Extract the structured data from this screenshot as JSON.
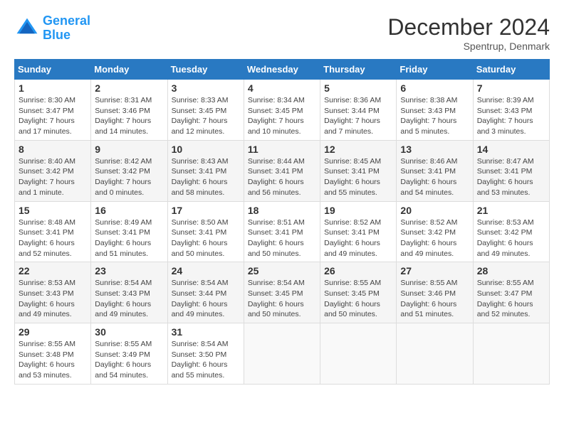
{
  "header": {
    "logo_line1": "General",
    "logo_line2": "Blue",
    "month": "December 2024",
    "location": "Spentrup, Denmark"
  },
  "weekdays": [
    "Sunday",
    "Monday",
    "Tuesday",
    "Wednesday",
    "Thursday",
    "Friday",
    "Saturday"
  ],
  "weeks": [
    [
      {
        "day": "1",
        "sunrise": "8:30 AM",
        "sunset": "3:47 PM",
        "daylight": "7 hours and 17 minutes."
      },
      {
        "day": "2",
        "sunrise": "8:31 AM",
        "sunset": "3:46 PM",
        "daylight": "7 hours and 14 minutes."
      },
      {
        "day": "3",
        "sunrise": "8:33 AM",
        "sunset": "3:45 PM",
        "daylight": "7 hours and 12 minutes."
      },
      {
        "day": "4",
        "sunrise": "8:34 AM",
        "sunset": "3:45 PM",
        "daylight": "7 hours and 10 minutes."
      },
      {
        "day": "5",
        "sunrise": "8:36 AM",
        "sunset": "3:44 PM",
        "daylight": "7 hours and 7 minutes."
      },
      {
        "day": "6",
        "sunrise": "8:38 AM",
        "sunset": "3:43 PM",
        "daylight": "7 hours and 5 minutes."
      },
      {
        "day": "7",
        "sunrise": "8:39 AM",
        "sunset": "3:43 PM",
        "daylight": "7 hours and 3 minutes."
      }
    ],
    [
      {
        "day": "8",
        "sunrise": "8:40 AM",
        "sunset": "3:42 PM",
        "daylight": "7 hours and 1 minute."
      },
      {
        "day": "9",
        "sunrise": "8:42 AM",
        "sunset": "3:42 PM",
        "daylight": "7 hours and 0 minutes."
      },
      {
        "day": "10",
        "sunrise": "8:43 AM",
        "sunset": "3:41 PM",
        "daylight": "6 hours and 58 minutes."
      },
      {
        "day": "11",
        "sunrise": "8:44 AM",
        "sunset": "3:41 PM",
        "daylight": "6 hours and 56 minutes."
      },
      {
        "day": "12",
        "sunrise": "8:45 AM",
        "sunset": "3:41 PM",
        "daylight": "6 hours and 55 minutes."
      },
      {
        "day": "13",
        "sunrise": "8:46 AM",
        "sunset": "3:41 PM",
        "daylight": "6 hours and 54 minutes."
      },
      {
        "day": "14",
        "sunrise": "8:47 AM",
        "sunset": "3:41 PM",
        "daylight": "6 hours and 53 minutes."
      }
    ],
    [
      {
        "day": "15",
        "sunrise": "8:48 AM",
        "sunset": "3:41 PM",
        "daylight": "6 hours and 52 minutes."
      },
      {
        "day": "16",
        "sunrise": "8:49 AM",
        "sunset": "3:41 PM",
        "daylight": "6 hours and 51 minutes."
      },
      {
        "day": "17",
        "sunrise": "8:50 AM",
        "sunset": "3:41 PM",
        "daylight": "6 hours and 50 minutes."
      },
      {
        "day": "18",
        "sunrise": "8:51 AM",
        "sunset": "3:41 PM",
        "daylight": "6 hours and 50 minutes."
      },
      {
        "day": "19",
        "sunrise": "8:52 AM",
        "sunset": "3:41 PM",
        "daylight": "6 hours and 49 minutes."
      },
      {
        "day": "20",
        "sunrise": "8:52 AM",
        "sunset": "3:42 PM",
        "daylight": "6 hours and 49 minutes."
      },
      {
        "day": "21",
        "sunrise": "8:53 AM",
        "sunset": "3:42 PM",
        "daylight": "6 hours and 49 minutes."
      }
    ],
    [
      {
        "day": "22",
        "sunrise": "8:53 AM",
        "sunset": "3:43 PM",
        "daylight": "6 hours and 49 minutes."
      },
      {
        "day": "23",
        "sunrise": "8:54 AM",
        "sunset": "3:43 PM",
        "daylight": "6 hours and 49 minutes."
      },
      {
        "day": "24",
        "sunrise": "8:54 AM",
        "sunset": "3:44 PM",
        "daylight": "6 hours and 49 minutes."
      },
      {
        "day": "25",
        "sunrise": "8:54 AM",
        "sunset": "3:45 PM",
        "daylight": "6 hours and 50 minutes."
      },
      {
        "day": "26",
        "sunrise": "8:55 AM",
        "sunset": "3:45 PM",
        "daylight": "6 hours and 50 minutes."
      },
      {
        "day": "27",
        "sunrise": "8:55 AM",
        "sunset": "3:46 PM",
        "daylight": "6 hours and 51 minutes."
      },
      {
        "day": "28",
        "sunrise": "8:55 AM",
        "sunset": "3:47 PM",
        "daylight": "6 hours and 52 minutes."
      }
    ],
    [
      {
        "day": "29",
        "sunrise": "8:55 AM",
        "sunset": "3:48 PM",
        "daylight": "6 hours and 53 minutes."
      },
      {
        "day": "30",
        "sunrise": "8:55 AM",
        "sunset": "3:49 PM",
        "daylight": "6 hours and 54 minutes."
      },
      {
        "day": "31",
        "sunrise": "8:54 AM",
        "sunset": "3:50 PM",
        "daylight": "6 hours and 55 minutes."
      },
      null,
      null,
      null,
      null
    ]
  ]
}
